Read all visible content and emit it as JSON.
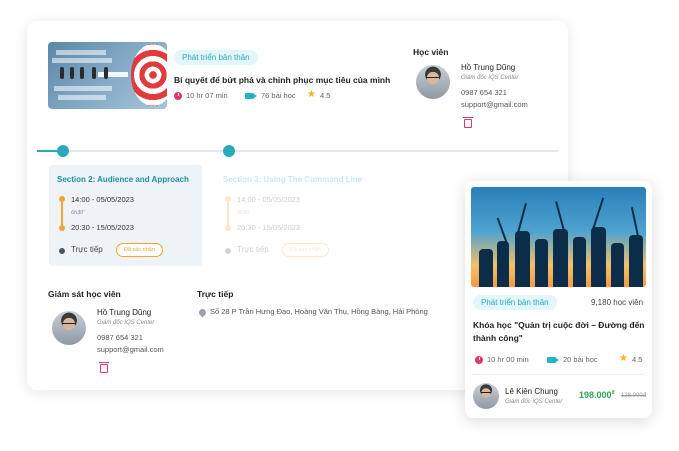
{
  "course": {
    "tag": "Phát triển bản thân",
    "title": "Bí quyết để bứt phá và chinh phục mục tiêu của mình",
    "duration": "10 hr 07 min",
    "lessons": "76 bài học",
    "rating": "4.5"
  },
  "student": {
    "heading": "Học viên",
    "name": "Hồ Trung Dũng",
    "role": "Giám đốc IQS Center",
    "phone": "0987 654 321",
    "email": "support@gmail.com"
  },
  "sessions": [
    {
      "title": "Section 2: Audience and Approach",
      "start": "14:00 - 05/05/2023",
      "duration": "6h30'",
      "end": "20:30 - 15/05/2023",
      "mode": "Trực tiếp",
      "button": "Đã xác nhận"
    },
    {
      "title": "Section 3: Using The Command Line",
      "start": "14:00 - 05/05/2023",
      "duration": "6h30'",
      "end": "20:30 - 15/05/2023",
      "mode": "Trực tiếp",
      "button": "Đã xác nhận"
    }
  ],
  "supervisor": {
    "heading": "Giám sát học viên",
    "name": "Hồ Trung Dũng",
    "role": "Giám đốc IQS Center",
    "phone": "0987 654 321",
    "email": "support@gmail.com"
  },
  "location": {
    "heading": "Trực tiếp",
    "address": "Số 28 P Trần Hưng Đạo, Hoàng Văn Thụ, Hồng Bàng, Hải Phòng"
  },
  "promo": {
    "tag": "Phát triển bản thân",
    "students": "9,180 học viên",
    "title": "Khóa học \"Quản trị cuộc đời – Đường đến thành công\"",
    "duration": "10 hr 00 min",
    "lessons": "20 bài học",
    "rating": "4.5",
    "instructor_name": "Lê Kiên Chung",
    "instructor_role": "Giám đốc IQS Center",
    "price": "198.000",
    "price_currency": "đ",
    "old_price": "128.000đ"
  },
  "colors": {
    "accent": "#2aa9bc",
    "pink": "#e6356f",
    "orange": "#f2a531",
    "green": "#27a852"
  },
  "icons": [
    "clock-icon",
    "video-icon",
    "star-icon",
    "trash-icon",
    "location-pin-icon",
    "target-icon"
  ]
}
